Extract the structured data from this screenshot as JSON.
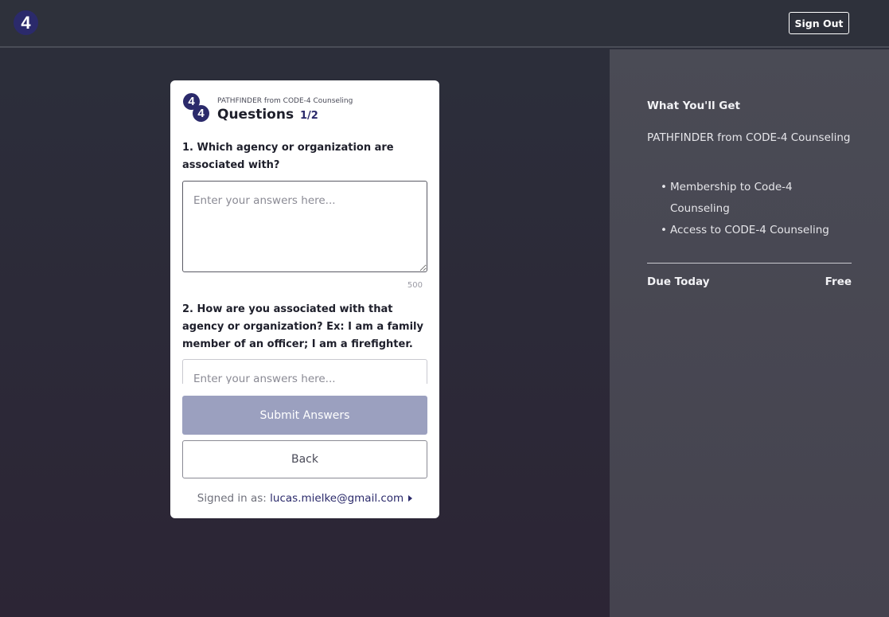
{
  "header": {
    "logo_text": "4",
    "signout_label": "Sign Out"
  },
  "card": {
    "logo_digits": [
      "4",
      "4"
    ],
    "subtitle": "PATHFINDER from CODE-4 Counseling",
    "title": "Questions",
    "step": "1/2",
    "questions": [
      {
        "label": "1. Which agency or organization are associated with?",
        "placeholder": "Enter your answers here...",
        "char_limit": "500"
      },
      {
        "label": "2. How are you associated with that agency or organization? Ex: I am a family member of an officer; I am a firefighter.",
        "placeholder": "Enter your answers here..."
      }
    ],
    "submit_label": "Submit Answers",
    "back_label": "Back",
    "signed_in_prefix": "Signed in as:",
    "signed_in_email": "lucas.mielke@gmail.com"
  },
  "summary": {
    "title": "What You'll Get",
    "product": "PATHFINDER from CODE-4 Counseling",
    "benefits": [
      "Membership to Code-4 Counseling",
      "Access to CODE-4 Counseling"
    ],
    "due_label": "Due Today",
    "due_value": "Free"
  },
  "colors": {
    "brand": "#2b2a6b",
    "submit_disabled": "#9ba0bf",
    "background": "#2c2f3b",
    "panel": "#464751"
  }
}
